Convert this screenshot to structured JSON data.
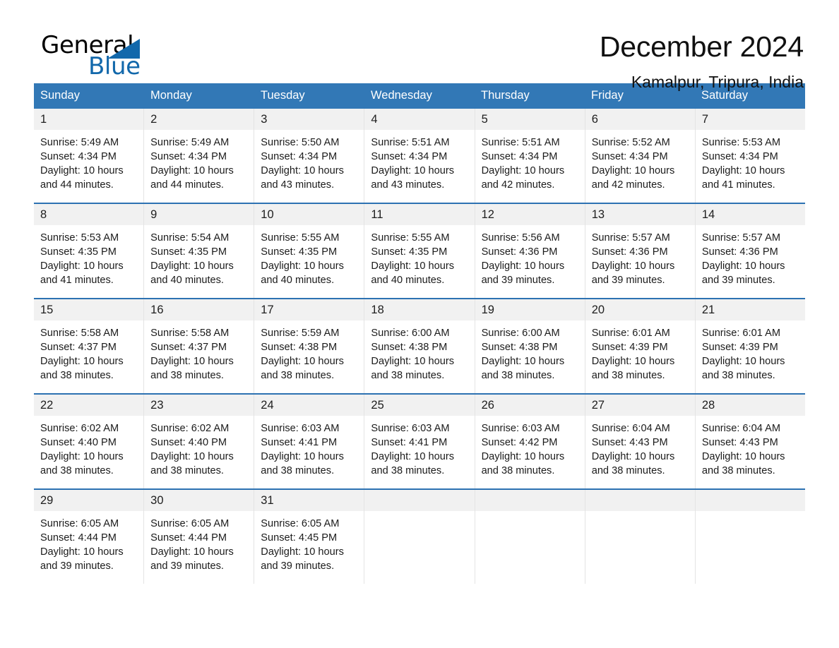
{
  "logo": {
    "word_one": "General",
    "word_two": "Blue",
    "triangle_icon": "triangle-icon",
    "brand_color": "#1268ab"
  },
  "header": {
    "title": "December 2024",
    "subtitle": "Kamalpur, Tripura, India"
  },
  "theme": {
    "header_blue": "#3278b6",
    "row_divider_blue": "#2d72b2",
    "daynum_band": "#f1f1f1"
  },
  "calendar": {
    "weekdays": [
      "Sunday",
      "Monday",
      "Tuesday",
      "Wednesday",
      "Thursday",
      "Friday",
      "Saturday"
    ],
    "weeks": [
      [
        {
          "day": "1",
          "sunrise": "Sunrise: 5:49 AM",
          "sunset": "Sunset: 4:34 PM",
          "daylight": "Daylight: 10 hours and 44 minutes."
        },
        {
          "day": "2",
          "sunrise": "Sunrise: 5:49 AM",
          "sunset": "Sunset: 4:34 PM",
          "daylight": "Daylight: 10 hours and 44 minutes."
        },
        {
          "day": "3",
          "sunrise": "Sunrise: 5:50 AM",
          "sunset": "Sunset: 4:34 PM",
          "daylight": "Daylight: 10 hours and 43 minutes."
        },
        {
          "day": "4",
          "sunrise": "Sunrise: 5:51 AM",
          "sunset": "Sunset: 4:34 PM",
          "daylight": "Daylight: 10 hours and 43 minutes."
        },
        {
          "day": "5",
          "sunrise": "Sunrise: 5:51 AM",
          "sunset": "Sunset: 4:34 PM",
          "daylight": "Daylight: 10 hours and 42 minutes."
        },
        {
          "day": "6",
          "sunrise": "Sunrise: 5:52 AM",
          "sunset": "Sunset: 4:34 PM",
          "daylight": "Daylight: 10 hours and 42 minutes."
        },
        {
          "day": "7",
          "sunrise": "Sunrise: 5:53 AM",
          "sunset": "Sunset: 4:34 PM",
          "daylight": "Daylight: 10 hours and 41 minutes."
        }
      ],
      [
        {
          "day": "8",
          "sunrise": "Sunrise: 5:53 AM",
          "sunset": "Sunset: 4:35 PM",
          "daylight": "Daylight: 10 hours and 41 minutes."
        },
        {
          "day": "9",
          "sunrise": "Sunrise: 5:54 AM",
          "sunset": "Sunset: 4:35 PM",
          "daylight": "Daylight: 10 hours and 40 minutes."
        },
        {
          "day": "10",
          "sunrise": "Sunrise: 5:55 AM",
          "sunset": "Sunset: 4:35 PM",
          "daylight": "Daylight: 10 hours and 40 minutes."
        },
        {
          "day": "11",
          "sunrise": "Sunrise: 5:55 AM",
          "sunset": "Sunset: 4:35 PM",
          "daylight": "Daylight: 10 hours and 40 minutes."
        },
        {
          "day": "12",
          "sunrise": "Sunrise: 5:56 AM",
          "sunset": "Sunset: 4:36 PM",
          "daylight": "Daylight: 10 hours and 39 minutes."
        },
        {
          "day": "13",
          "sunrise": "Sunrise: 5:57 AM",
          "sunset": "Sunset: 4:36 PM",
          "daylight": "Daylight: 10 hours and 39 minutes."
        },
        {
          "day": "14",
          "sunrise": "Sunrise: 5:57 AM",
          "sunset": "Sunset: 4:36 PM",
          "daylight": "Daylight: 10 hours and 39 minutes."
        }
      ],
      [
        {
          "day": "15",
          "sunrise": "Sunrise: 5:58 AM",
          "sunset": "Sunset: 4:37 PM",
          "daylight": "Daylight: 10 hours and 38 minutes."
        },
        {
          "day": "16",
          "sunrise": "Sunrise: 5:58 AM",
          "sunset": "Sunset: 4:37 PM",
          "daylight": "Daylight: 10 hours and 38 minutes."
        },
        {
          "day": "17",
          "sunrise": "Sunrise: 5:59 AM",
          "sunset": "Sunset: 4:38 PM",
          "daylight": "Daylight: 10 hours and 38 minutes."
        },
        {
          "day": "18",
          "sunrise": "Sunrise: 6:00 AM",
          "sunset": "Sunset: 4:38 PM",
          "daylight": "Daylight: 10 hours and 38 minutes."
        },
        {
          "day": "19",
          "sunrise": "Sunrise: 6:00 AM",
          "sunset": "Sunset: 4:38 PM",
          "daylight": "Daylight: 10 hours and 38 minutes."
        },
        {
          "day": "20",
          "sunrise": "Sunrise: 6:01 AM",
          "sunset": "Sunset: 4:39 PM",
          "daylight": "Daylight: 10 hours and 38 minutes."
        },
        {
          "day": "21",
          "sunrise": "Sunrise: 6:01 AM",
          "sunset": "Sunset: 4:39 PM",
          "daylight": "Daylight: 10 hours and 38 minutes."
        }
      ],
      [
        {
          "day": "22",
          "sunrise": "Sunrise: 6:02 AM",
          "sunset": "Sunset: 4:40 PM",
          "daylight": "Daylight: 10 hours and 38 minutes."
        },
        {
          "day": "23",
          "sunrise": "Sunrise: 6:02 AM",
          "sunset": "Sunset: 4:40 PM",
          "daylight": "Daylight: 10 hours and 38 minutes."
        },
        {
          "day": "24",
          "sunrise": "Sunrise: 6:03 AM",
          "sunset": "Sunset: 4:41 PM",
          "daylight": "Daylight: 10 hours and 38 minutes."
        },
        {
          "day": "25",
          "sunrise": "Sunrise: 6:03 AM",
          "sunset": "Sunset: 4:41 PM",
          "daylight": "Daylight: 10 hours and 38 minutes."
        },
        {
          "day": "26",
          "sunrise": "Sunrise: 6:03 AM",
          "sunset": "Sunset: 4:42 PM",
          "daylight": "Daylight: 10 hours and 38 minutes."
        },
        {
          "day": "27",
          "sunrise": "Sunrise: 6:04 AM",
          "sunset": "Sunset: 4:43 PM",
          "daylight": "Daylight: 10 hours and 38 minutes."
        },
        {
          "day": "28",
          "sunrise": "Sunrise: 6:04 AM",
          "sunset": "Sunset: 4:43 PM",
          "daylight": "Daylight: 10 hours and 38 minutes."
        }
      ],
      [
        {
          "day": "29",
          "sunrise": "Sunrise: 6:05 AM",
          "sunset": "Sunset: 4:44 PM",
          "daylight": "Daylight: 10 hours and 39 minutes."
        },
        {
          "day": "30",
          "sunrise": "Sunrise: 6:05 AM",
          "sunset": "Sunset: 4:44 PM",
          "daylight": "Daylight: 10 hours and 39 minutes."
        },
        {
          "day": "31",
          "sunrise": "Sunrise: 6:05 AM",
          "sunset": "Sunset: 4:45 PM",
          "daylight": "Daylight: 10 hours and 39 minutes."
        },
        {
          "day": "",
          "sunrise": "",
          "sunset": "",
          "daylight": ""
        },
        {
          "day": "",
          "sunrise": "",
          "sunset": "",
          "daylight": ""
        },
        {
          "day": "",
          "sunrise": "",
          "sunset": "",
          "daylight": ""
        },
        {
          "day": "",
          "sunrise": "",
          "sunset": "",
          "daylight": ""
        }
      ]
    ]
  }
}
